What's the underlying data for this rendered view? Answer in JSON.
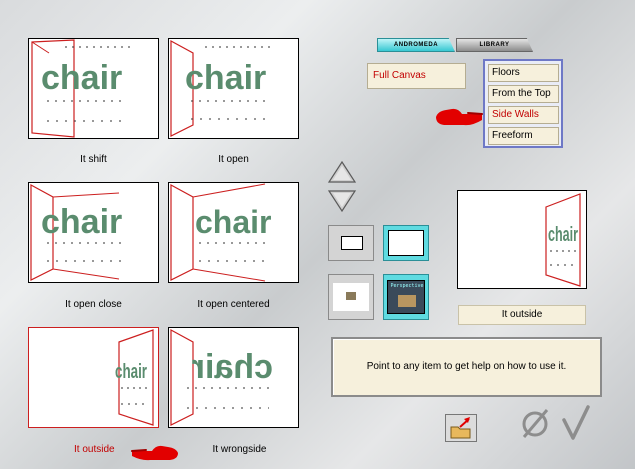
{
  "tabs": [
    {
      "label": "ANDROMEDA",
      "active": true
    },
    {
      "label": "LIBRARY",
      "active": false
    }
  ],
  "canvas_option": "Full Canvas",
  "menu": {
    "items": [
      "Floors",
      "From the Top",
      "Side Walls",
      "Freeform"
    ],
    "selected": "Side Walls"
  },
  "thumbnails": [
    {
      "caption": "It shift",
      "selected": false
    },
    {
      "caption": "It open",
      "selected": false
    },
    {
      "caption": "It open close",
      "selected": false
    },
    {
      "caption": "It open centered",
      "selected": false
    },
    {
      "caption": "It outside",
      "selected": true
    },
    {
      "caption": "It wrongside",
      "selected": false
    }
  ],
  "thumb_text": "chair",
  "preview_label": "It outside",
  "perspective_label": "Perspective",
  "help_text": "Point to any item to get help on how to use it.",
  "colors": {
    "selected_text": "#c20000",
    "accent_cyan": "#5fdbe1",
    "wall_red": "#cc1f1f",
    "chair_green": "#5a8c6e",
    "panel_beige": "#f6f0dc",
    "menu_border": "#6e78c6"
  },
  "icons": [
    "pointing-hand-icon",
    "arrow-up-icon",
    "arrow-down-icon",
    "cancel-icon",
    "check-icon",
    "folder-export-icon"
  ]
}
